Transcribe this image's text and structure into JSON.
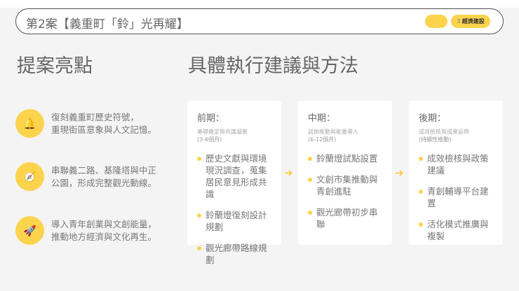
{
  "header": {
    "title": "第2案【義重町「鈴」光再耀】",
    "tag_number": "3.",
    "tag_label": "經濟建設"
  },
  "left": {
    "title": "提案亮點",
    "items": [
      {
        "icon": "bell-icon",
        "glyph": "🔔",
        "line1": "復刻義重町歷史符號，",
        "line2": "重現街區意象與人文記憶。"
      },
      {
        "icon": "compass-icon",
        "glyph": "🧭",
        "line1": "串聯義二路、基隆塔與中正",
        "line2": "公園，形成完整觀光動線。"
      },
      {
        "icon": "rocket-icon",
        "glyph": "🚀",
        "line1": "導入青年創業與文創能量，",
        "line2": "推動地方經濟與文化再生。"
      }
    ]
  },
  "right": {
    "title": "具體執行建議與方法",
    "arrow": "➜",
    "phases": [
      {
        "title": "前期：",
        "subtitle": "基礎奠定與共識凝聚",
        "duration": "(3-6個月)",
        "bullets": [
          "歷史文獻與環境現況調查，蒐集居民意見形成共識",
          "鈴蘭燈復刻設計規劃",
          "觀光廊帶路線規劃"
        ]
      },
      {
        "title": "中期：",
        "subtitle": "試辦推動與能量導入",
        "duration": "(6-12個月)",
        "bullets": [
          "鈴蘭燈試點設置",
          "文創市集推動與青創進駐",
          "觀光廊帶初步串聯"
        ]
      },
      {
        "title": "後期：",
        "subtitle": "成效檢核與成果延伸",
        "duration": "(持續性推動)",
        "bullets": [
          "成效檢核與政策建議",
          "青創輔導平台建置",
          "活化模式推廣與複製"
        ]
      }
    ]
  }
}
